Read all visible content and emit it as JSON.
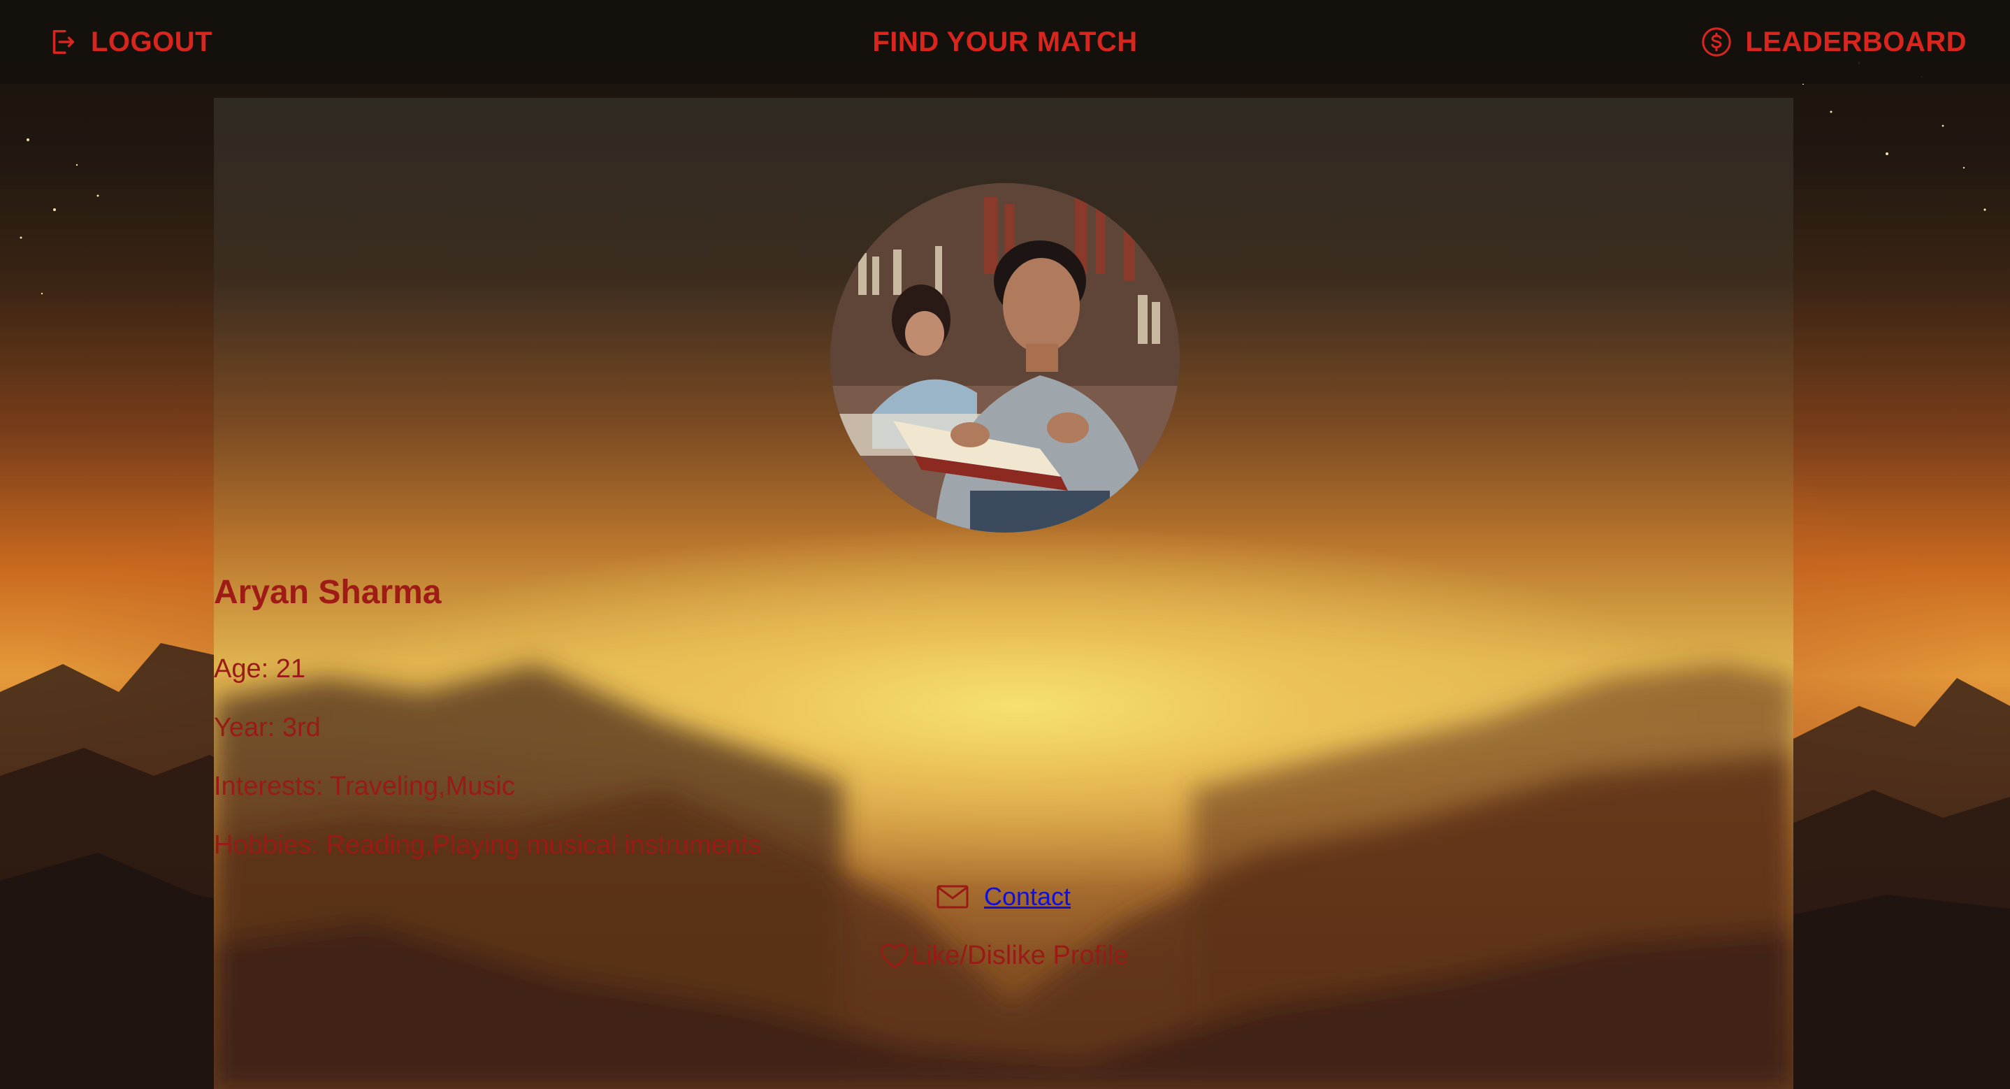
{
  "nav": {
    "logout_label": "LOGOUT",
    "center_label": "FIND YOUR MATCH",
    "leaderboard_label": "LEADERBOARD",
    "logout_icon": "logout-icon",
    "leaderboard_icon": "dollar-circle-icon"
  },
  "profile": {
    "photo_description": "profile-photo",
    "name": "Aryan Sharma",
    "age": "Age: 21",
    "year": "Year: 3rd",
    "interests": "Interests: Traveling,Music",
    "hobbies": "Hobbies: Reading,Playing musical instruments",
    "contact_icon": "mail-icon",
    "contact_label": "Contact",
    "like_icon": "heart-icon",
    "like_label": "Like/Dislike Profile"
  },
  "colors": {
    "accent": "#d8261f",
    "text": "#9a1a15",
    "link": "#1010d8"
  }
}
